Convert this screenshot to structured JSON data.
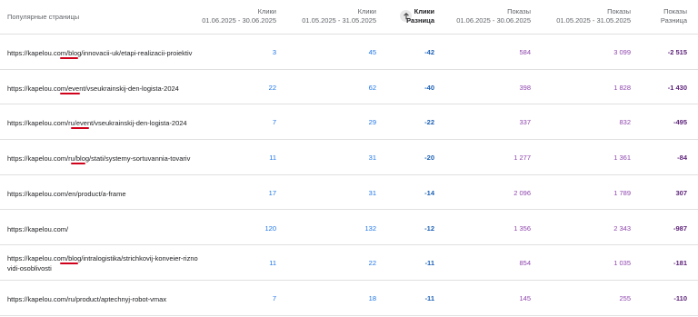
{
  "header": {
    "pages": "Популярные страницы",
    "clicks_label": "Клики",
    "impressions_label": "Показы",
    "diff_label": "Разница",
    "period_current": "01.06.2025 - 30.06.2025",
    "period_previous": "01.05.2025 - 31.05.2025"
  },
  "rows": [
    {
      "url": "https://kapelou.com/blog/innovacii-uk/etapi-realizacii-proiektiv",
      "url2": "",
      "clicks_cur": "3",
      "clicks_prev": "45",
      "clicks_diff": "-42",
      "impr_cur": "584",
      "impr_prev": "3 099",
      "impr_diff": "-2 515"
    },
    {
      "url": "https://kapelou.com/event/vseukrainskij-den-logista-2024",
      "url2": "",
      "clicks_cur": "22",
      "clicks_prev": "62",
      "clicks_diff": "-40",
      "impr_cur": "398",
      "impr_prev": "1 828",
      "impr_diff": "-1 430"
    },
    {
      "url": "https://kapelou.com/ru/event/vseukrainskij-den-logista-2024",
      "url2": "",
      "clicks_cur": "7",
      "clicks_prev": "29",
      "clicks_diff": "-22",
      "impr_cur": "337",
      "impr_prev": "832",
      "impr_diff": "-495"
    },
    {
      "url": "https://kapelou.com/ru/blog/stati/systemy-sortuvannia-tovariv",
      "url2": "",
      "clicks_cur": "11",
      "clicks_prev": "31",
      "clicks_diff": "-20",
      "impr_cur": "1 277",
      "impr_prev": "1 361",
      "impr_diff": "-84"
    },
    {
      "url": "https://kapelou.com/en/product/a-frame",
      "url2": "",
      "clicks_cur": "17",
      "clicks_prev": "31",
      "clicks_diff": "-14",
      "impr_cur": "2 096",
      "impr_prev": "1 789",
      "impr_diff": "307"
    },
    {
      "url": "https://kapelou.com/",
      "url2": "",
      "clicks_cur": "120",
      "clicks_prev": "132",
      "clicks_diff": "-12",
      "impr_cur": "1 356",
      "impr_prev": "2 343",
      "impr_diff": "-987"
    },
    {
      "url": "https://kapelou.com/blog/intralogistika/strichkovij-konveier-rizno",
      "url2": "vidi-osoblivosti",
      "clicks_cur": "11",
      "clicks_prev": "22",
      "clicks_diff": "-11",
      "impr_cur": "854",
      "impr_prev": "1 035",
      "impr_diff": "-181"
    },
    {
      "url": "https://kapelou.com/ru/product/aptechnyj-robot-vmax",
      "url2": "",
      "clicks_cur": "7",
      "clicks_prev": "18",
      "clicks_diff": "-11",
      "impr_cur": "145",
      "impr_prev": "255",
      "impr_diff": "-110"
    }
  ],
  "colors": {
    "clicks": "#1a73e8",
    "clicks_diff": "#1a5fb4",
    "impressions": "#8e44ad",
    "impressions_diff": "#5b1f78",
    "annotation": "#d0021b"
  },
  "icons": {
    "sort": "arrow-up-icon"
  }
}
